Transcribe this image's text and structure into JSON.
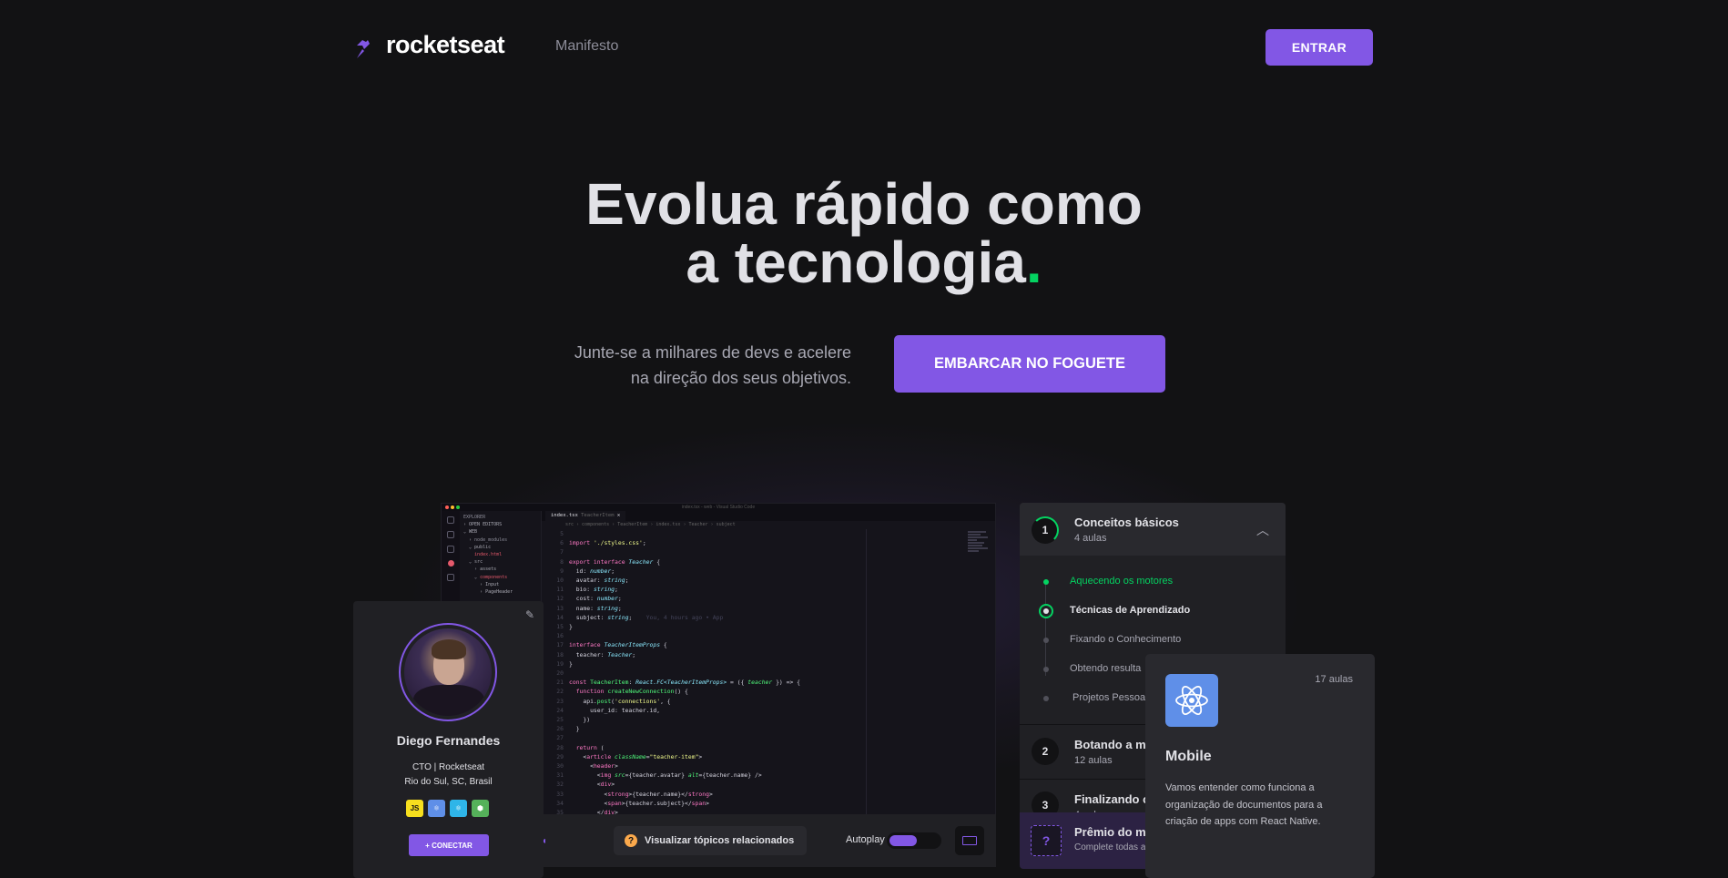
{
  "header": {
    "logo_text": "rocketseat",
    "nav_manifesto": "Manifesto",
    "login_button": "ENTRAR"
  },
  "hero": {
    "title_line1": "Evolua rápido como",
    "title_line2": "a tecnologia",
    "title_dot": ".",
    "subtitle_line1": "Junte-se a milhares de devs e acelere",
    "subtitle_line2": "na direção dos seus objetivos.",
    "cta_button": "EMBARCAR NO FOGUETE"
  },
  "colors": {
    "accent": "#8257e5",
    "green": "#04d361",
    "background": "#121214",
    "card": "#202024"
  },
  "editor": {
    "window_title": "index.tsx - web - Visual Studio Code",
    "tab_label": "index.tsx",
    "tab_path": "TeacherItem",
    "breadcrumb": "src › components › TeacherItem › index.tsx › Teacher › subject",
    "explorer": {
      "header": "EXPLORER",
      "open_editors": "OPEN EDITORS",
      "web": "WEB",
      "items": [
        "node_modules",
        "public",
        "index.html",
        "src",
        "assets",
        "components",
        "Input",
        "PageHeader"
      ]
    },
    "blame": "You, 4 hours ago • App"
  },
  "bottom_bar": {
    "related_topics": "Visualizar tópicos relacionados",
    "related_icon": "question-icon",
    "autoplay_label": "Autoplay",
    "autoplay_on": true
  },
  "profile": {
    "name": "Diego Fernandes",
    "role": "CTO | Rocketseat",
    "location": "Rio do Sul, SC, Brasil",
    "techs": [
      {
        "label": "JS",
        "icon": "javascript-icon",
        "bg": "#f7df1e",
        "fg": "#121214"
      },
      {
        "label": "⚛",
        "icon": "react-icon",
        "bg": "#5f8fe8",
        "fg": "#ffffff"
      },
      {
        "label": "⚛",
        "icon": "react-native-icon",
        "bg": "#2fb5e8",
        "fg": "#ffffff"
      },
      {
        "label": "⬢",
        "icon": "node-icon",
        "bg": "#55b15a",
        "fg": "#ffffff"
      }
    ],
    "connect_button": "+ CONECTAR"
  },
  "course": {
    "module1": {
      "number": "1",
      "title": "Conceitos básicos",
      "subtitle": "4 aulas"
    },
    "lessons": [
      {
        "label": "Aquecendo os motores",
        "state": "done"
      },
      {
        "label": "Técnicas de Aprendizado",
        "state": "current"
      },
      {
        "label": "Fixando o Conhecimento",
        "state": "pending"
      },
      {
        "label": "Obtendo resulta",
        "state": "pending"
      },
      {
        "label": "Projetos Pessoa",
        "state": "pending"
      }
    ],
    "module2": {
      "number": "2",
      "title": "Botando a mã",
      "subtitle": "12 aulas"
    },
    "module3": {
      "number": "3",
      "title": "Finalizando o",
      "subtitle": "4 aulas"
    },
    "prize": {
      "icon": "?",
      "title": "Prêmio do mo",
      "subtitle": "Complete todas a"
    }
  },
  "mobile_card": {
    "icon": "react-icon",
    "lessons_count": "17 aulas",
    "title": "Mobile",
    "description": "Vamos entender como funciona a organização de documentos para a criação de apps com React Native."
  }
}
